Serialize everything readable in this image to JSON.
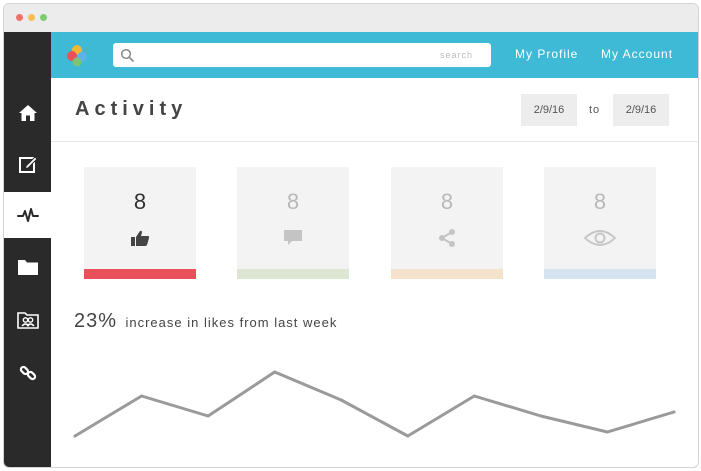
{
  "colors": {
    "topbar": "#3ebad6",
    "sidebar": "#2a2a2a",
    "likes_bar": "#e8505a",
    "comments_bar": "#dce6d2",
    "shares_bar": "#f4e2cc",
    "views_bar": "#d6e4f2",
    "line": "#9a9a9a"
  },
  "sidebar": {
    "items": [
      {
        "icon": "home-icon"
      },
      {
        "icon": "edit-icon"
      },
      {
        "icon": "activity-icon",
        "active": true
      },
      {
        "icon": "folder-icon"
      },
      {
        "icon": "contacts-icon"
      },
      {
        "icon": "link-icon"
      }
    ]
  },
  "topbar": {
    "search_hint": "search",
    "search_value": "",
    "profile_link": "My Profile",
    "account_link": "My Account"
  },
  "header": {
    "title": "Activity",
    "date_from": "2/9/16",
    "date_separator": "to",
    "date_to": "2/9/16"
  },
  "cards": [
    {
      "value": "8",
      "icon": "thumbs-up-icon"
    },
    {
      "value": "8",
      "icon": "comment-icon"
    },
    {
      "value": "8",
      "icon": "share-icon"
    },
    {
      "value": "8",
      "icon": "eye-icon"
    }
  ],
  "stat": {
    "percent": "23%",
    "description": "increase in likes from last week"
  },
  "chart_data": {
    "type": "line",
    "values": [
      0.1,
      0.6,
      0.35,
      0.9,
      0.55,
      0.1,
      0.6,
      0.35,
      0.15,
      0.4
    ],
    "ylim": [
      0,
      1
    ]
  }
}
